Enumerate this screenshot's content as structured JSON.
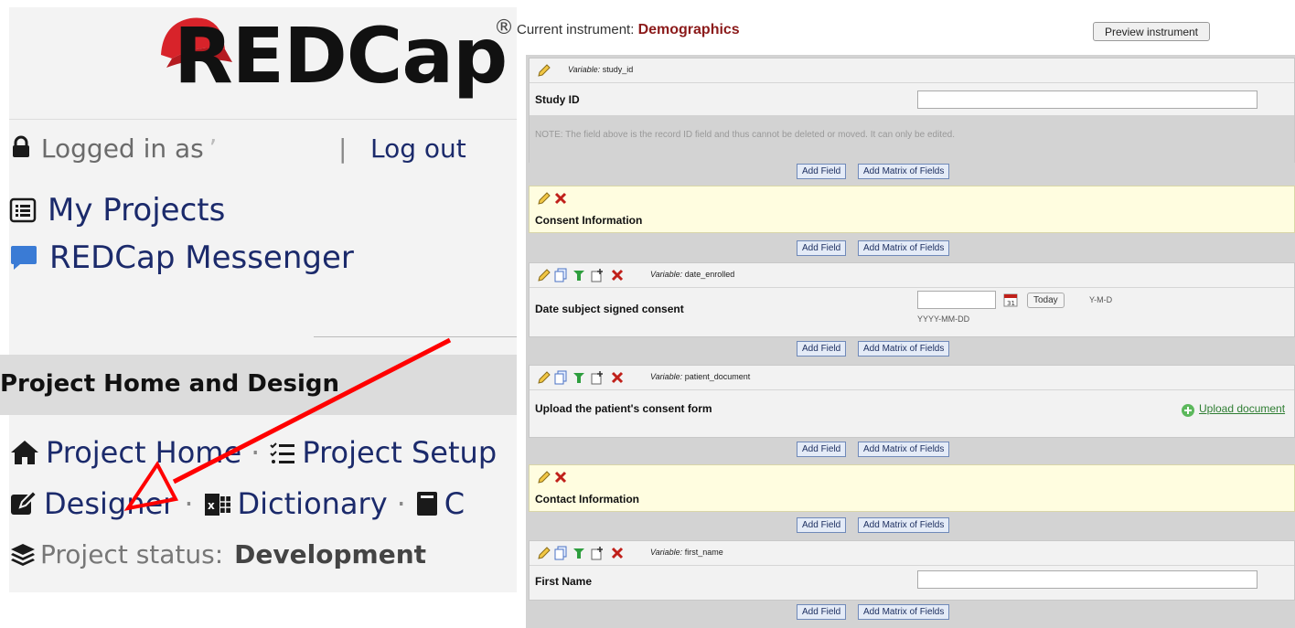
{
  "left": {
    "logo_text": "REDCap",
    "logo_reg": "®",
    "logged_in_prefix": "Logged in as",
    "logout_label": "Log out",
    "nav": [
      {
        "label": "My Projects",
        "icon": "list-icon"
      },
      {
        "label": "REDCap Messenger",
        "icon": "chat-bubble-icon"
      }
    ],
    "section_title": "Project Home and Design",
    "row1": {
      "project_home": "Project Home",
      "project_setup": "Project Setup"
    },
    "row2": {
      "designer": "Designer",
      "dictionary": "Dictionary",
      "codebook_partial": "C"
    },
    "status_label": "Project status:",
    "status_value": "Development",
    "arrow_color": "#ff0000"
  },
  "right": {
    "current_instrument_label": "Current instrument:",
    "current_instrument_name": "Demographics",
    "preview_button": "Preview instrument",
    "add_field": "Add Field",
    "add_matrix": "Add Matrix of Fields",
    "variable_prefix": "Variable:",
    "fields": [
      {
        "variable": "study_id",
        "label": "Study ID"
      },
      {
        "section": "Consent Information"
      },
      {
        "variable": "date_enrolled",
        "label": "Date subject signed consent",
        "today": "Today",
        "format_hint": "Y-M-D",
        "format_below": "YYYY-MM-DD"
      },
      {
        "variable": "patient_document",
        "label": "Upload the patient's consent form",
        "upload": "Upload document"
      },
      {
        "section": "Contact Information"
      },
      {
        "variable": "first_name",
        "label": "First Name"
      }
    ],
    "record_id_note": "NOTE: The field above is the record ID field and thus cannot be deleted or moved. It can only be edited.",
    "colors": {
      "instrument_name": "#8b1a1a",
      "section_bg": "#fffde0",
      "upload_link": "#2e7d32"
    }
  }
}
